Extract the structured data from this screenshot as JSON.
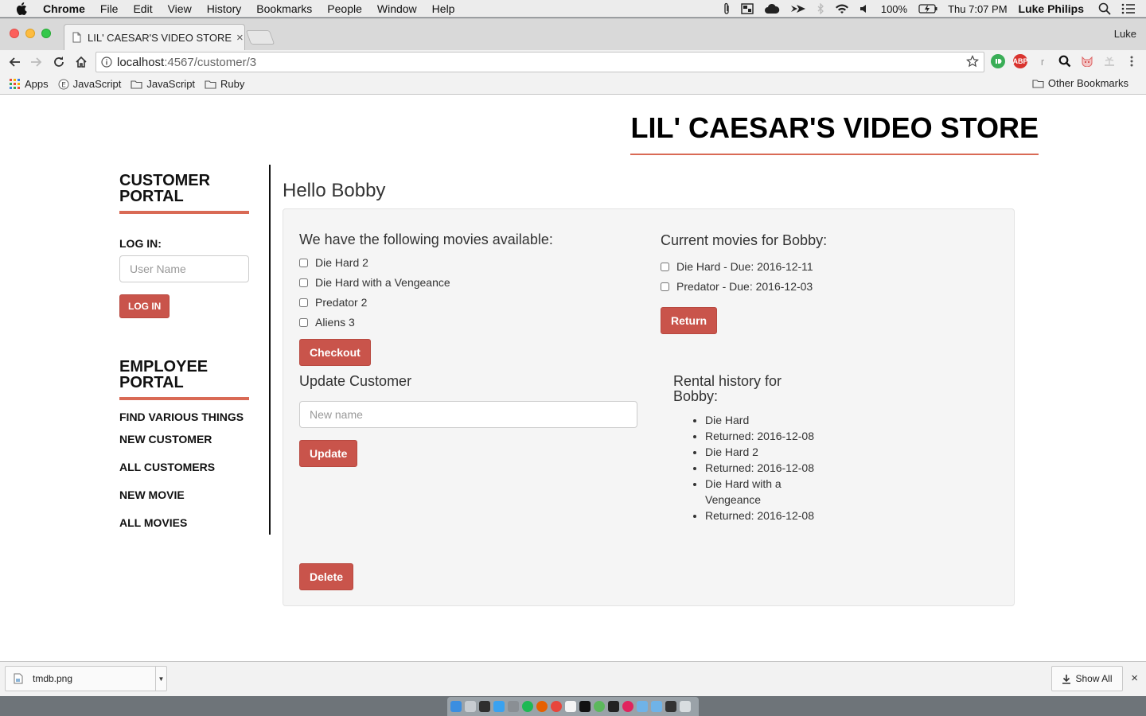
{
  "menubar": {
    "app_name": "Chrome",
    "items": [
      "File",
      "Edit",
      "View",
      "History",
      "Bookmarks",
      "People",
      "Window",
      "Help"
    ],
    "battery": "100%",
    "clock": "Thu 7:07 PM",
    "user": "Luke Philips"
  },
  "browser": {
    "tab_title": "LIL' CAESAR'S VIDEO STORE",
    "tab_close": "×",
    "profile_name": "Luke",
    "url_host": "localhost",
    "url_path": ":4567/customer/3",
    "extension_abp": "ABP",
    "extension_r": "r"
  },
  "bookmarks": {
    "items": [
      "Apps",
      "JavaScript",
      "JavaScript",
      "Ruby"
    ],
    "other": "Other Bookmarks"
  },
  "page": {
    "store_title": "LIL' CAESAR'S VIDEO STORE",
    "hello": "Hello Bobby",
    "customer_portal": {
      "heading_line1": "CUSTOMER",
      "heading_line2": "PORTAL",
      "login_label": "LOG IN:",
      "username_placeholder": "User Name",
      "login_button": "LOG IN"
    },
    "employee_portal": {
      "heading_line1": "EMPLOYEE",
      "heading_line2": "PORTAL",
      "links": [
        "FIND VARIOUS THINGS",
        "NEW CUSTOMER",
        "ALL CUSTOMERS",
        "NEW MOVIE",
        "ALL MOVIES"
      ]
    },
    "available": {
      "heading": "We have the following movies available:",
      "movies": [
        "Die Hard 2",
        "Die Hard with a Vengeance",
        "Predator 2",
        "Aliens 3"
      ],
      "checkout_button": "Checkout"
    },
    "current": {
      "heading": "Current movies for Bobby:",
      "movies": [
        "Die Hard - Due: 2016-12-11",
        "Predator - Due: 2016-12-03"
      ],
      "return_button": "Return"
    },
    "update": {
      "heading": "Update Customer",
      "placeholder": "New name",
      "update_button": "Update"
    },
    "history": {
      "heading": "Rental history for Bobby:",
      "items": [
        "Die Hard",
        "Returned: 2016-12-08",
        "Die Hard 2",
        "Returned: 2016-12-08",
        "Die Hard with a Vengeance",
        "Returned: 2016-12-08"
      ]
    },
    "delete_button": "Delete"
  },
  "downloads": {
    "file_name": "tmdb.png",
    "show_all": "Show All",
    "close": "×"
  },
  "colors": {
    "accent": "#d96a55",
    "button": "#c9544b",
    "panel_bg": "#f5f5f5"
  }
}
